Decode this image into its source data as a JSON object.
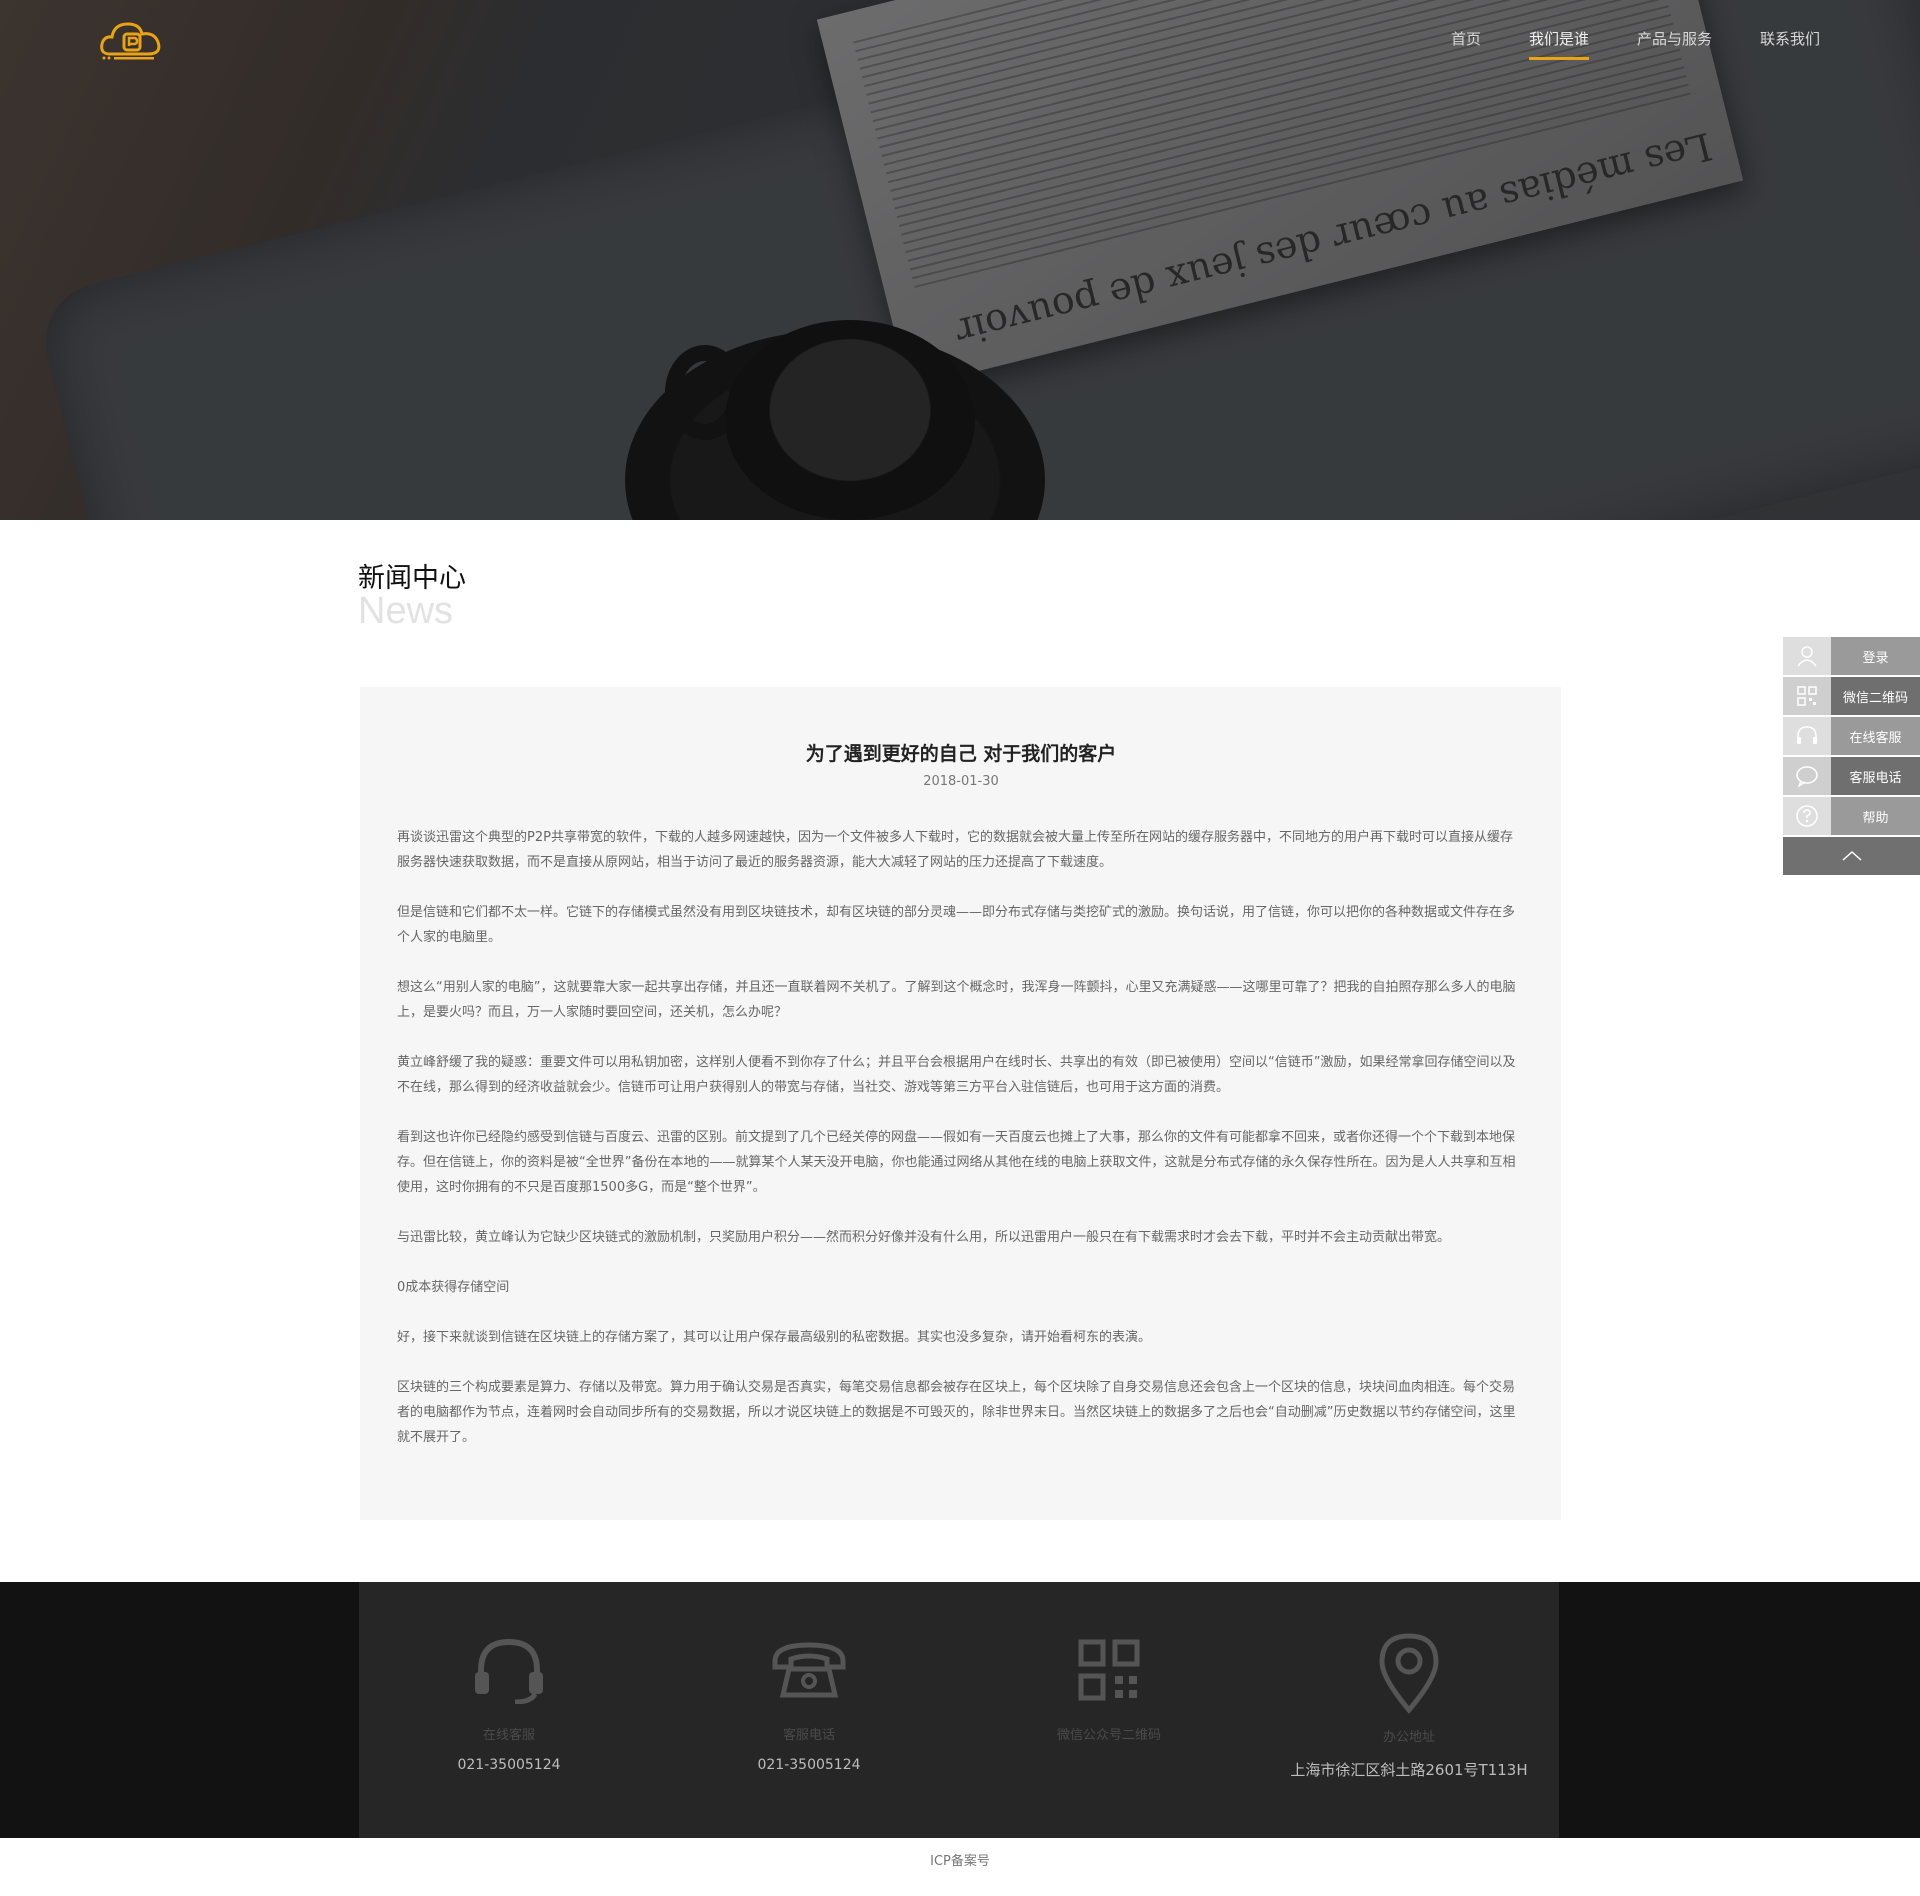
{
  "header": {
    "logo_icon": "cloud-p-logo",
    "nav": [
      {
        "label": "首页",
        "active": false
      },
      {
        "label": "我们是谁",
        "active": true
      },
      {
        "label": "产品与服务",
        "active": false
      },
      {
        "label": "联系我们",
        "active": false
      }
    ],
    "accent_color": "#e8a317"
  },
  "hero": {
    "headline_text": "Les médias au cœur des jeux de pouvoir"
  },
  "section": {
    "title": "新闻中心",
    "subtitle": "News"
  },
  "article": {
    "title": "为了遇到更好的自己 对于我们的客户",
    "date": "2018-01-30",
    "paragraphs": [
      "再谈谈迅雷这个典型的P2P共享带宽的软件，下载的人越多网速越快，因为一个文件被多人下载时，它的数据就会被大量上传至所在网站的缓存服务器中，不同地方的用户再下载时可以直接从缓存服务器快速获取数据，而不是直接从原网站，相当于访问了最近的服务器资源，能大大减轻了网站的压力还提高了下载速度。",
      "但是信链和它们都不太一样。它链下的存储模式虽然没有用到区块链技术，却有区块链的部分灵魂——即分布式存储与类挖矿式的激励。换句话说，用了信链，你可以把你的各种数据或文件存在多个人家的电脑里。",
      "想这么“用别人家的电脑”，这就要靠大家一起共享出存储，并且还一直联着网不关机了。了解到这个概念时，我浑身一阵颤抖，心里又充满疑惑——这哪里可靠了？把我的自拍照存那么多人的电脑上，是要火吗？而且，万一人家随时要回空间，还关机，怎么办呢？",
      "黄立峰舒缓了我的疑惑：重要文件可以用私钥加密，这样别人便看不到你存了什么；并且平台会根据用户在线时长、共享出的有效（即已被使用）空间以“信链币”激励，如果经常拿回存储空间以及不在线，那么得到的经济收益就会少。信链币可让用户获得别人的带宽与存储，当社交、游戏等第三方平台入驻信链后，也可用于这方面的消费。",
      "看到这也许你已经隐约感受到信链与百度云、迅雷的区别。前文提到了几个已经关停的网盘——假如有一天百度云也摊上了大事，那么你的文件有可能都拿不回来，或者你还得一个个下载到本地保存。但在信链上，你的资料是被“全世界”备份在本地的——就算某个人某天没开电脑，你也能通过网络从其他在线的电脑上获取文件，这就是分布式存储的永久保存性所在。因为是人人共享和互相使用，这时你拥有的不只是百度那1500多G，而是“整个世界”。",
      "与迅雷比较，黄立峰认为它缺少区块链式的激励机制，只奖励用户积分——然而积分好像并没有什么用，所以迅雷用户一般只在有下载需求时才会去下载，平时并不会主动贡献出带宽。",
      "0成本获得存储空间",
      "好，接下来就谈到信链在区块链上的存储方案了，其可以让用户保存最高级别的私密数据。其实也没多复杂，请开始看柯东的表演。",
      "区块链的三个构成要素是算力、存储以及带宽。算力用于确认交易是否真实，每笔交易信息都会被存在区块上，每个区块除了自身交易信息还会包含上一个区块的信息，块块间血肉相连。每个交易者的电脑都作为节点，连着网时会自动同步所有的交易数据，所以才说区块链上的数据是不可毁灭的，除非世界末日。当然区块链上的数据多了之后也会“自动删减”历史数据以节约存储空间，这里就不展开了。"
    ]
  },
  "sidebar": {
    "items": [
      {
        "label": "登录",
        "icon": "user-icon"
      },
      {
        "label": "微信二维码",
        "icon": "qrcode-icon"
      },
      {
        "label": "在线客服",
        "icon": "headset-icon"
      },
      {
        "label": "客服电话",
        "icon": "chat-bubble-icon"
      },
      {
        "label": "帮助",
        "icon": "help-icon"
      }
    ],
    "back_to_top_icon": "chevron-up-icon"
  },
  "footer": {
    "columns": [
      {
        "icon": "headset-icon",
        "label": "在线客服",
        "value": "021-35005124"
      },
      {
        "icon": "phone-icon",
        "label": "客服电话",
        "value": "021-35005124"
      },
      {
        "icon": "qrcode-icon",
        "label": "微信公众号二维码",
        "value": ""
      },
      {
        "icon": "location-pin-icon",
        "label": "办公地址",
        "value": "上海市徐汇区斜土路2601号T113H"
      }
    ],
    "icp": "ICP备案号"
  }
}
